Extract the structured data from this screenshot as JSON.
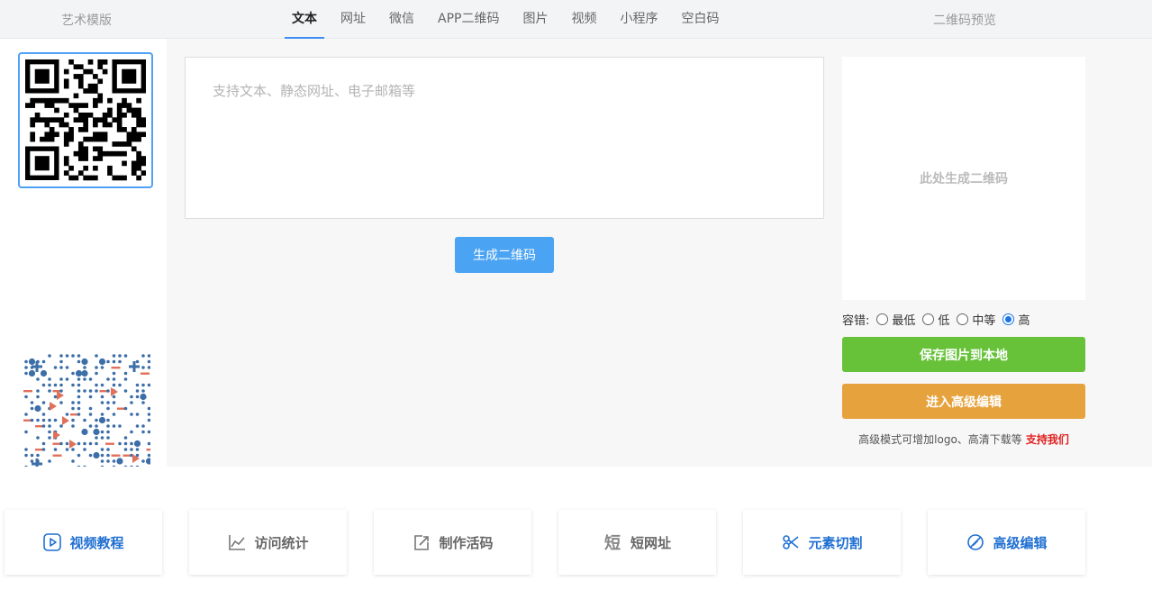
{
  "header": {
    "left_title": "艺术模版",
    "right_title": "二维码预览",
    "tabs": [
      {
        "label": "文本",
        "active": true
      },
      {
        "label": "网址",
        "active": false
      },
      {
        "label": "微信",
        "active": false
      },
      {
        "label": "APP二维码",
        "active": false
      },
      {
        "label": "图片",
        "active": false
      },
      {
        "label": "视频",
        "active": false
      },
      {
        "label": "小程序",
        "active": false
      },
      {
        "label": "空白码",
        "active": false
      }
    ]
  },
  "editor": {
    "placeholder": "支持文本、静态网址、电子邮箱等",
    "value": "",
    "generate_label": "生成二维码"
  },
  "preview": {
    "placeholder": "此处生成二维码",
    "tolerance_label": "容错:",
    "tolerance_options": [
      {
        "label": "最低",
        "checked": false
      },
      {
        "label": "低",
        "checked": false
      },
      {
        "label": "中等",
        "checked": false
      },
      {
        "label": "高",
        "checked": true
      }
    ],
    "save_label": "保存图片到本地",
    "advanced_label": "进入高级编辑",
    "note": "高级模式可增加logo、高清下载等",
    "support_label": "支持我们"
  },
  "features": [
    {
      "label": "视频教程",
      "icon": "play-icon",
      "color": "#1f6fd1"
    },
    {
      "label": "访问统计",
      "icon": "chart-icon",
      "color": "#666666"
    },
    {
      "label": "制作活码",
      "icon": "share-edit-icon",
      "color": "#666666"
    },
    {
      "label": "短网址",
      "icon": "short-char-icon",
      "color": "#666666"
    },
    {
      "label": "元素切割",
      "icon": "scissors-icon",
      "color": "#1f6fd1"
    },
    {
      "label": "高级编辑",
      "icon": "edit-slash-icon",
      "color": "#1f6fd1"
    }
  ],
  "colors": {
    "accent": "#4aa3f3",
    "save": "#67c23a",
    "advanced": "#e6a23c",
    "support": "#e02020"
  }
}
